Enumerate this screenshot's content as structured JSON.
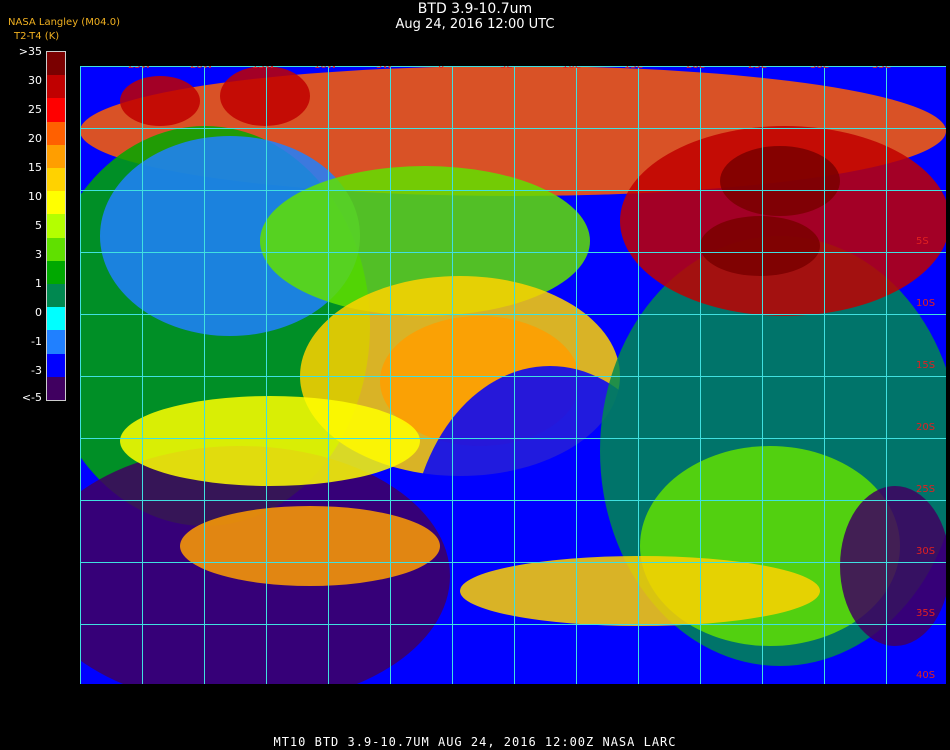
{
  "header": {
    "title": "BTD 3.9-10.7um",
    "subtitle": "Aug 24, 2016 12:00 UTC",
    "org": "NASA Langley (M04.0)",
    "unit_label": "T2-T4 (K)"
  },
  "legend": {
    "ticks": [
      ">35",
      "30",
      "25",
      "20",
      "15",
      "10",
      "5",
      "3",
      "1",
      "0",
      "-1",
      "-3",
      "<-5"
    ],
    "colors": [
      "#7a0000",
      "#c00000",
      "#ff0000",
      "#ff6000",
      "#ff9e00",
      "#ffd200",
      "#ffff00",
      "#b4ff00",
      "#60e000",
      "#00a800",
      "#008850",
      "#00ffff",
      "#2080ff",
      "#0000ff",
      "#400060"
    ]
  },
  "map": {
    "lon_labels": [
      "25W",
      "20W",
      "15W",
      "10W",
      "5W",
      "0",
      "5E",
      "10E",
      "15E",
      "20E",
      "25E",
      "30E",
      "35E"
    ],
    "lat_labels": [
      "5S",
      "10S",
      "15S",
      "20S",
      "25S",
      "30S",
      "35S",
      "40S"
    ]
  },
  "footer": {
    "text": "MT10   BTD 3.9-10.7UM   AUG 24, 2016 12:00Z   NASA LARC"
  }
}
